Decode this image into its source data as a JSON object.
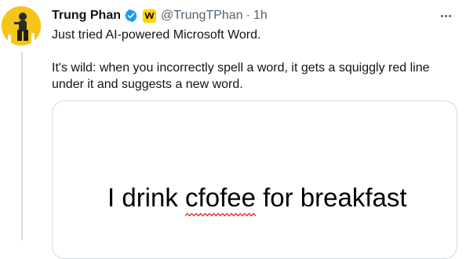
{
  "tweet": {
    "author_name": "Trung Phan",
    "handle": "@TrungTPhan",
    "separator": "·",
    "time": "1h",
    "affiliation_badge_letter": "W",
    "verified_color": "#1d9bf0",
    "affiliation_color": "#ffd400",
    "text_line_1": "Just tried AI-powered Microsoft Word.",
    "text_line_2": "It's wild: when you incorrectly spell a word, it gets a squiggly red line under it and suggests a new word."
  },
  "media": {
    "before": "I drink ",
    "misspelled_word": "cfofee",
    "after": " for breakfast",
    "squiggle_color": "#e02020"
  },
  "icons": {
    "avatar": "avatar-icon",
    "verified": "verified-badge-icon",
    "affiliation": "affiliation-badge-icon",
    "more": "more-options-icon"
  }
}
